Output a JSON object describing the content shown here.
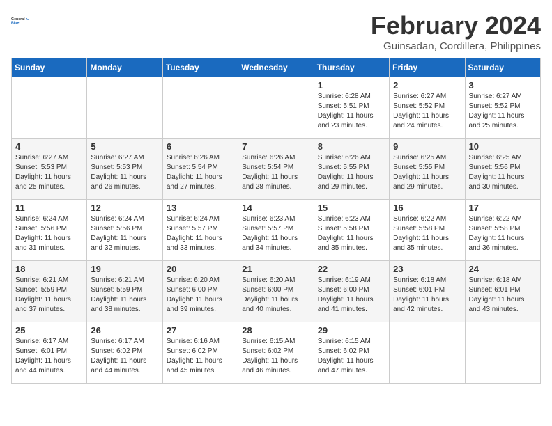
{
  "logo": {
    "line1": "General",
    "line2": "Blue"
  },
  "title": "February 2024",
  "subtitle": "Guinsadan, Cordillera, Philippines",
  "weekdays": [
    "Sunday",
    "Monday",
    "Tuesday",
    "Wednesday",
    "Thursday",
    "Friday",
    "Saturday"
  ],
  "weeks": [
    [
      {
        "day": "",
        "info": ""
      },
      {
        "day": "",
        "info": ""
      },
      {
        "day": "",
        "info": ""
      },
      {
        "day": "",
        "info": ""
      },
      {
        "day": "1",
        "info": "Sunrise: 6:28 AM\nSunset: 5:51 PM\nDaylight: 11 hours\nand 23 minutes."
      },
      {
        "day": "2",
        "info": "Sunrise: 6:27 AM\nSunset: 5:52 PM\nDaylight: 11 hours\nand 24 minutes."
      },
      {
        "day": "3",
        "info": "Sunrise: 6:27 AM\nSunset: 5:52 PM\nDaylight: 11 hours\nand 25 minutes."
      }
    ],
    [
      {
        "day": "4",
        "info": "Sunrise: 6:27 AM\nSunset: 5:53 PM\nDaylight: 11 hours\nand 25 minutes."
      },
      {
        "day": "5",
        "info": "Sunrise: 6:27 AM\nSunset: 5:53 PM\nDaylight: 11 hours\nand 26 minutes."
      },
      {
        "day": "6",
        "info": "Sunrise: 6:26 AM\nSunset: 5:54 PM\nDaylight: 11 hours\nand 27 minutes."
      },
      {
        "day": "7",
        "info": "Sunrise: 6:26 AM\nSunset: 5:54 PM\nDaylight: 11 hours\nand 28 minutes."
      },
      {
        "day": "8",
        "info": "Sunrise: 6:26 AM\nSunset: 5:55 PM\nDaylight: 11 hours\nand 29 minutes."
      },
      {
        "day": "9",
        "info": "Sunrise: 6:25 AM\nSunset: 5:55 PM\nDaylight: 11 hours\nand 29 minutes."
      },
      {
        "day": "10",
        "info": "Sunrise: 6:25 AM\nSunset: 5:56 PM\nDaylight: 11 hours\nand 30 minutes."
      }
    ],
    [
      {
        "day": "11",
        "info": "Sunrise: 6:24 AM\nSunset: 5:56 PM\nDaylight: 11 hours\nand 31 minutes."
      },
      {
        "day": "12",
        "info": "Sunrise: 6:24 AM\nSunset: 5:56 PM\nDaylight: 11 hours\nand 32 minutes."
      },
      {
        "day": "13",
        "info": "Sunrise: 6:24 AM\nSunset: 5:57 PM\nDaylight: 11 hours\nand 33 minutes."
      },
      {
        "day": "14",
        "info": "Sunrise: 6:23 AM\nSunset: 5:57 PM\nDaylight: 11 hours\nand 34 minutes."
      },
      {
        "day": "15",
        "info": "Sunrise: 6:23 AM\nSunset: 5:58 PM\nDaylight: 11 hours\nand 35 minutes."
      },
      {
        "day": "16",
        "info": "Sunrise: 6:22 AM\nSunset: 5:58 PM\nDaylight: 11 hours\nand 35 minutes."
      },
      {
        "day": "17",
        "info": "Sunrise: 6:22 AM\nSunset: 5:58 PM\nDaylight: 11 hours\nand 36 minutes."
      }
    ],
    [
      {
        "day": "18",
        "info": "Sunrise: 6:21 AM\nSunset: 5:59 PM\nDaylight: 11 hours\nand 37 minutes."
      },
      {
        "day": "19",
        "info": "Sunrise: 6:21 AM\nSunset: 5:59 PM\nDaylight: 11 hours\nand 38 minutes."
      },
      {
        "day": "20",
        "info": "Sunrise: 6:20 AM\nSunset: 6:00 PM\nDaylight: 11 hours\nand 39 minutes."
      },
      {
        "day": "21",
        "info": "Sunrise: 6:20 AM\nSunset: 6:00 PM\nDaylight: 11 hours\nand 40 minutes."
      },
      {
        "day": "22",
        "info": "Sunrise: 6:19 AM\nSunset: 6:00 PM\nDaylight: 11 hours\nand 41 minutes."
      },
      {
        "day": "23",
        "info": "Sunrise: 6:18 AM\nSunset: 6:01 PM\nDaylight: 11 hours\nand 42 minutes."
      },
      {
        "day": "24",
        "info": "Sunrise: 6:18 AM\nSunset: 6:01 PM\nDaylight: 11 hours\nand 43 minutes."
      }
    ],
    [
      {
        "day": "25",
        "info": "Sunrise: 6:17 AM\nSunset: 6:01 PM\nDaylight: 11 hours\nand 44 minutes."
      },
      {
        "day": "26",
        "info": "Sunrise: 6:17 AM\nSunset: 6:02 PM\nDaylight: 11 hours\nand 44 minutes."
      },
      {
        "day": "27",
        "info": "Sunrise: 6:16 AM\nSunset: 6:02 PM\nDaylight: 11 hours\nand 45 minutes."
      },
      {
        "day": "28",
        "info": "Sunrise: 6:15 AM\nSunset: 6:02 PM\nDaylight: 11 hours\nand 46 minutes."
      },
      {
        "day": "29",
        "info": "Sunrise: 6:15 AM\nSunset: 6:02 PM\nDaylight: 11 hours\nand 47 minutes."
      },
      {
        "day": "",
        "info": ""
      },
      {
        "day": "",
        "info": ""
      }
    ]
  ]
}
